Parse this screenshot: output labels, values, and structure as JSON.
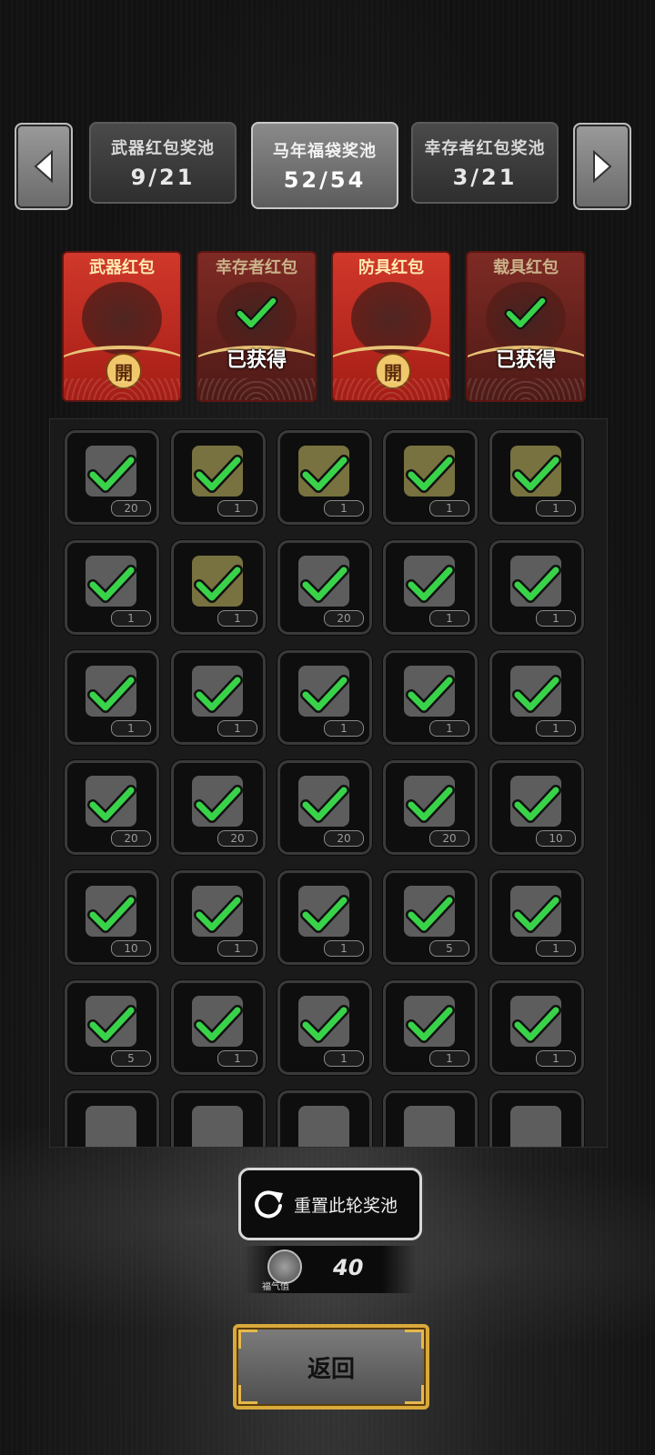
{
  "tabs": {
    "items": [
      {
        "label": "武器红包奖池",
        "count": "9/21",
        "active": false
      },
      {
        "label": "马年福袋奖池",
        "count": "52/54",
        "active": true
      },
      {
        "label": "幸存者红包奖池",
        "count": "3/21",
        "active": false
      }
    ]
  },
  "packets": [
    {
      "title": "武器红包",
      "state": "open",
      "open_glyph": "開"
    },
    {
      "title": "幸存者红包",
      "state": "obtained",
      "obtained_text": "已获得"
    },
    {
      "title": "防具红包",
      "state": "open",
      "open_glyph": "開"
    },
    {
      "title": "载具红包",
      "state": "obtained",
      "obtained_text": "已获得"
    }
  ],
  "grid": {
    "rows": [
      [
        "20",
        "1",
        "1",
        "1",
        "1"
      ],
      [
        "1",
        "1",
        "20",
        "1",
        "1"
      ],
      [
        "1",
        "1",
        "1",
        "1",
        "1"
      ],
      [
        "20",
        "20",
        "20",
        "20",
        "10"
      ],
      [
        "10",
        "1",
        "1",
        "5",
        "1"
      ],
      [
        "5",
        "1",
        "1",
        "1",
        "1"
      ]
    ]
  },
  "reset": {
    "label": "重置此轮奖池"
  },
  "luck": {
    "label": "福气值",
    "value": "40"
  },
  "back": {
    "label": "返回"
  },
  "colors": {
    "check": "#39d34a",
    "red_packet": "#c7301f",
    "gold_border": "#d9a93c"
  }
}
